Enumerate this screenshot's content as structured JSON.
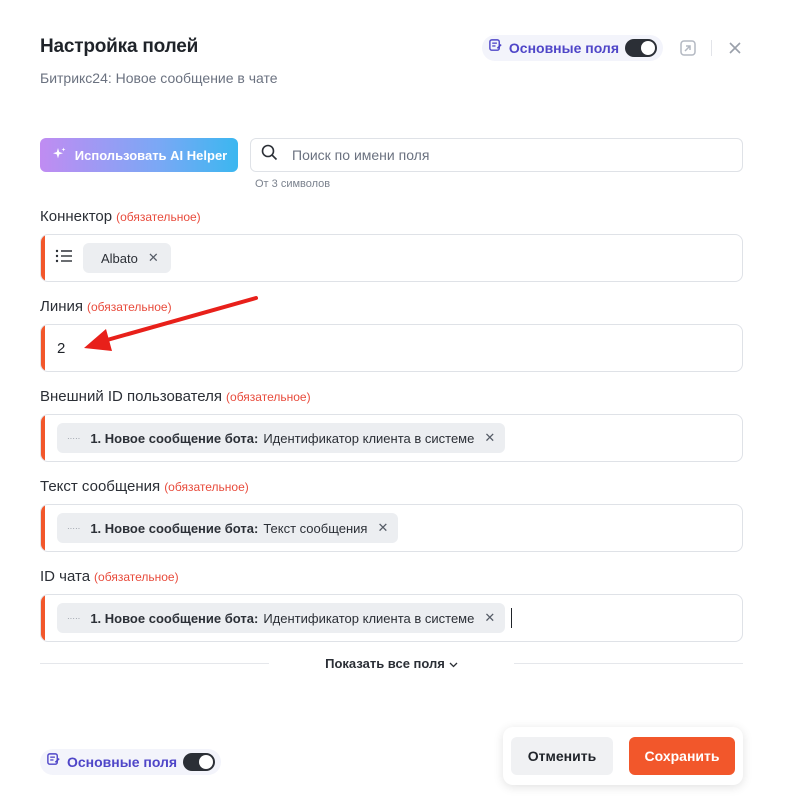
{
  "header": {
    "title": "Настройка полей",
    "subtitle": "Битрикс24: Новое сообщение в чате",
    "toggle_label": "Основные поля",
    "toggle_on": true
  },
  "ai_helper": {
    "label": "Использовать AI Helper"
  },
  "search": {
    "placeholder": "Поиск по имени поля",
    "value": "",
    "hint": "От 3 символов"
  },
  "fields": [
    {
      "label": "Коннектор",
      "required": "(обязательное)",
      "chip_text": "Albato"
    },
    {
      "label": "Линия",
      "required": "(обязательное)",
      "value": "2"
    },
    {
      "label": "Внешний ID пользователя",
      "required": "(обязательное)",
      "chip_bold": "1. Новое сообщение бота:",
      "chip_text": "Идентификатор клиента в системе"
    },
    {
      "label": "Текст сообщения",
      "required": "(обязательное)",
      "chip_bold": "1. Новое сообщение бота:",
      "chip_text": "Текст сообщения"
    },
    {
      "label": "ID чата",
      "required": "(обязательное)",
      "chip_bold": "1. Новое сообщение бота:",
      "chip_text": "Идентификатор клиента в системе"
    }
  ],
  "show_all": {
    "label": "Показать все поля"
  },
  "footer": {
    "toggle_label": "Основные поля",
    "toggle_on": true,
    "cancel_label": "Отменить",
    "save_label": "Сохранить"
  },
  "colors": {
    "accent": "#f2572b",
    "required": "#e84b3c",
    "toggle_label": "#4f46c8",
    "annotation_arrow": "#e8201a"
  },
  "icons": [
    "fields-settings-icon",
    "collapse-icon",
    "close-icon",
    "sparkle-icon",
    "search-icon",
    "list-icon",
    "chip-remove-icon",
    "variable-icon",
    "chevron-down-icon"
  ]
}
